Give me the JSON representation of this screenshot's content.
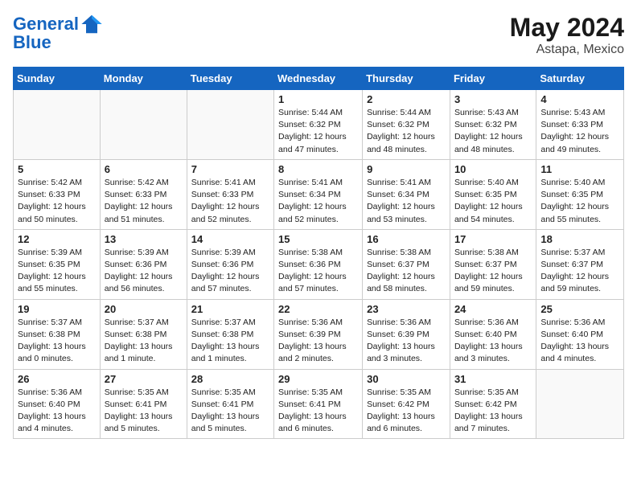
{
  "logo": {
    "line1": "General",
    "line2": "Blue"
  },
  "title": "May 2024",
  "location": "Astapa, Mexico",
  "days_of_week": [
    "Sunday",
    "Monday",
    "Tuesday",
    "Wednesday",
    "Thursday",
    "Friday",
    "Saturday"
  ],
  "weeks": [
    [
      {
        "day": "",
        "info": ""
      },
      {
        "day": "",
        "info": ""
      },
      {
        "day": "",
        "info": ""
      },
      {
        "day": "1",
        "info": "Sunrise: 5:44 AM\nSunset: 6:32 PM\nDaylight: 12 hours\nand 47 minutes."
      },
      {
        "day": "2",
        "info": "Sunrise: 5:44 AM\nSunset: 6:32 PM\nDaylight: 12 hours\nand 48 minutes."
      },
      {
        "day": "3",
        "info": "Sunrise: 5:43 AM\nSunset: 6:32 PM\nDaylight: 12 hours\nand 48 minutes."
      },
      {
        "day": "4",
        "info": "Sunrise: 5:43 AM\nSunset: 6:33 PM\nDaylight: 12 hours\nand 49 minutes."
      }
    ],
    [
      {
        "day": "5",
        "info": "Sunrise: 5:42 AM\nSunset: 6:33 PM\nDaylight: 12 hours\nand 50 minutes."
      },
      {
        "day": "6",
        "info": "Sunrise: 5:42 AM\nSunset: 6:33 PM\nDaylight: 12 hours\nand 51 minutes."
      },
      {
        "day": "7",
        "info": "Sunrise: 5:41 AM\nSunset: 6:33 PM\nDaylight: 12 hours\nand 52 minutes."
      },
      {
        "day": "8",
        "info": "Sunrise: 5:41 AM\nSunset: 6:34 PM\nDaylight: 12 hours\nand 52 minutes."
      },
      {
        "day": "9",
        "info": "Sunrise: 5:41 AM\nSunset: 6:34 PM\nDaylight: 12 hours\nand 53 minutes."
      },
      {
        "day": "10",
        "info": "Sunrise: 5:40 AM\nSunset: 6:35 PM\nDaylight: 12 hours\nand 54 minutes."
      },
      {
        "day": "11",
        "info": "Sunrise: 5:40 AM\nSunset: 6:35 PM\nDaylight: 12 hours\nand 55 minutes."
      }
    ],
    [
      {
        "day": "12",
        "info": "Sunrise: 5:39 AM\nSunset: 6:35 PM\nDaylight: 12 hours\nand 55 minutes."
      },
      {
        "day": "13",
        "info": "Sunrise: 5:39 AM\nSunset: 6:36 PM\nDaylight: 12 hours\nand 56 minutes."
      },
      {
        "day": "14",
        "info": "Sunrise: 5:39 AM\nSunset: 6:36 PM\nDaylight: 12 hours\nand 57 minutes."
      },
      {
        "day": "15",
        "info": "Sunrise: 5:38 AM\nSunset: 6:36 PM\nDaylight: 12 hours\nand 57 minutes."
      },
      {
        "day": "16",
        "info": "Sunrise: 5:38 AM\nSunset: 6:37 PM\nDaylight: 12 hours\nand 58 minutes."
      },
      {
        "day": "17",
        "info": "Sunrise: 5:38 AM\nSunset: 6:37 PM\nDaylight: 12 hours\nand 59 minutes."
      },
      {
        "day": "18",
        "info": "Sunrise: 5:37 AM\nSunset: 6:37 PM\nDaylight: 12 hours\nand 59 minutes."
      }
    ],
    [
      {
        "day": "19",
        "info": "Sunrise: 5:37 AM\nSunset: 6:38 PM\nDaylight: 13 hours\nand 0 minutes."
      },
      {
        "day": "20",
        "info": "Sunrise: 5:37 AM\nSunset: 6:38 PM\nDaylight: 13 hours\nand 1 minute."
      },
      {
        "day": "21",
        "info": "Sunrise: 5:37 AM\nSunset: 6:38 PM\nDaylight: 13 hours\nand 1 minutes."
      },
      {
        "day": "22",
        "info": "Sunrise: 5:36 AM\nSunset: 6:39 PM\nDaylight: 13 hours\nand 2 minutes."
      },
      {
        "day": "23",
        "info": "Sunrise: 5:36 AM\nSunset: 6:39 PM\nDaylight: 13 hours\nand 3 minutes."
      },
      {
        "day": "24",
        "info": "Sunrise: 5:36 AM\nSunset: 6:40 PM\nDaylight: 13 hours\nand 3 minutes."
      },
      {
        "day": "25",
        "info": "Sunrise: 5:36 AM\nSunset: 6:40 PM\nDaylight: 13 hours\nand 4 minutes."
      }
    ],
    [
      {
        "day": "26",
        "info": "Sunrise: 5:36 AM\nSunset: 6:40 PM\nDaylight: 13 hours\nand 4 minutes."
      },
      {
        "day": "27",
        "info": "Sunrise: 5:35 AM\nSunset: 6:41 PM\nDaylight: 13 hours\nand 5 minutes."
      },
      {
        "day": "28",
        "info": "Sunrise: 5:35 AM\nSunset: 6:41 PM\nDaylight: 13 hours\nand 5 minutes."
      },
      {
        "day": "29",
        "info": "Sunrise: 5:35 AM\nSunset: 6:41 PM\nDaylight: 13 hours\nand 6 minutes."
      },
      {
        "day": "30",
        "info": "Sunrise: 5:35 AM\nSunset: 6:42 PM\nDaylight: 13 hours\nand 6 minutes."
      },
      {
        "day": "31",
        "info": "Sunrise: 5:35 AM\nSunset: 6:42 PM\nDaylight: 13 hours\nand 7 minutes."
      },
      {
        "day": "",
        "info": ""
      }
    ]
  ]
}
